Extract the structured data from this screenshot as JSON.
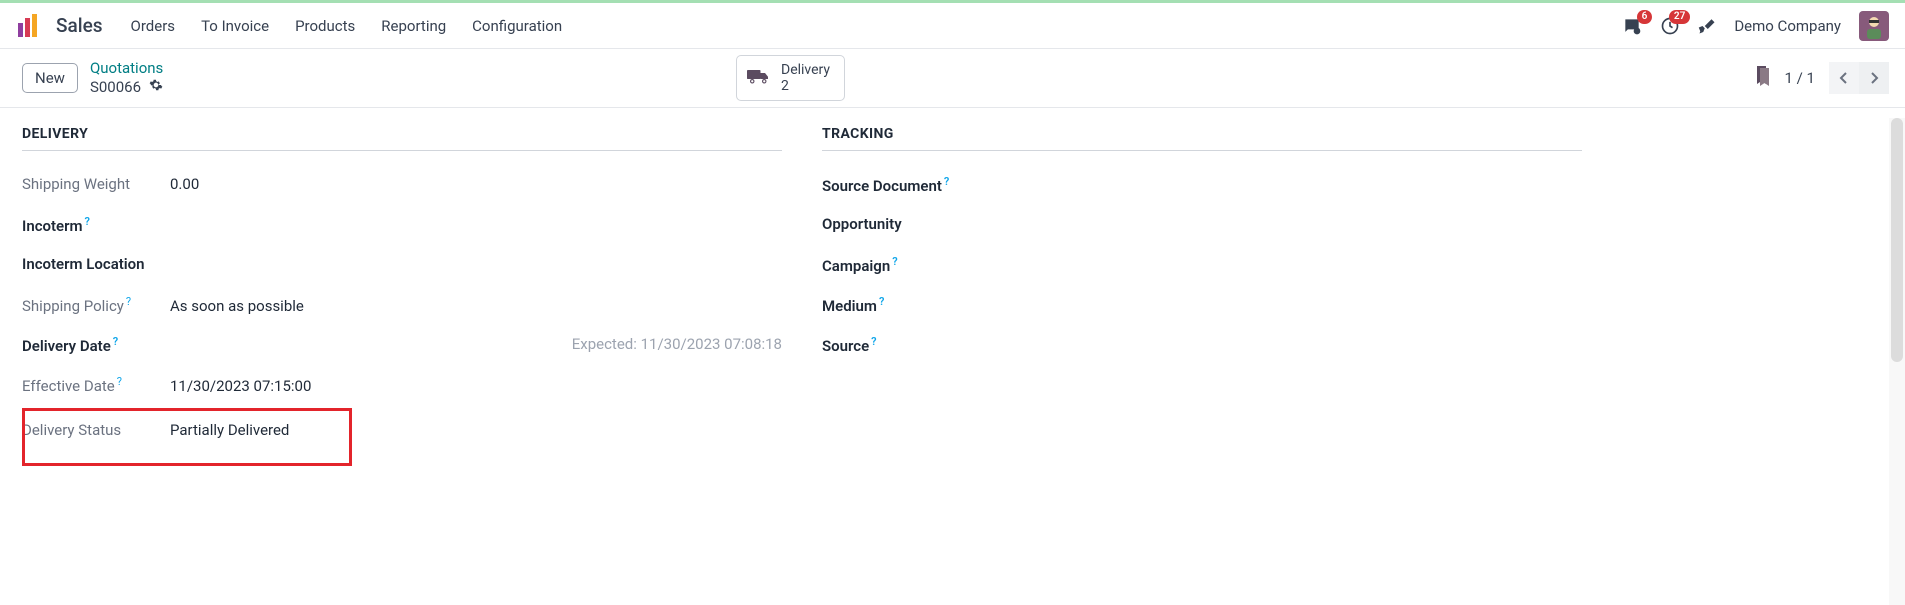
{
  "header": {
    "app_title": "Sales",
    "nav": [
      "Orders",
      "To Invoice",
      "Products",
      "Reporting",
      "Configuration"
    ],
    "messages_badge": "6",
    "activities_badge": "27",
    "company": "Demo Company"
  },
  "subheader": {
    "status_btn": "New",
    "breadcrumb": "Quotations",
    "order_no": "S00066",
    "delivery_label": "Delivery",
    "delivery_count": "2",
    "page_count": "1 / 1"
  },
  "delivery": {
    "title": "DELIVERY",
    "fields": {
      "shipping_weight_label": "Shipping Weight",
      "shipping_weight_value": "0.00",
      "incoterm_label": "Incoterm",
      "incoterm_location_label": "Incoterm Location",
      "shipping_policy_label": "Shipping Policy",
      "shipping_policy_value": "As soon as possible",
      "delivery_date_label": "Delivery Date",
      "delivery_date_aux": "Expected: 11/30/2023 07:08:18",
      "effective_date_label": "Effective Date",
      "effective_date_value": "11/30/2023 07:15:00",
      "delivery_status_label": "Delivery Status",
      "delivery_status_value": "Partially Delivered"
    }
  },
  "tracking": {
    "title": "TRACKING",
    "fields": {
      "source_document_label": "Source Document",
      "opportunity_label": "Opportunity",
      "campaign_label": "Campaign",
      "medium_label": "Medium",
      "source_label": "Source"
    }
  }
}
